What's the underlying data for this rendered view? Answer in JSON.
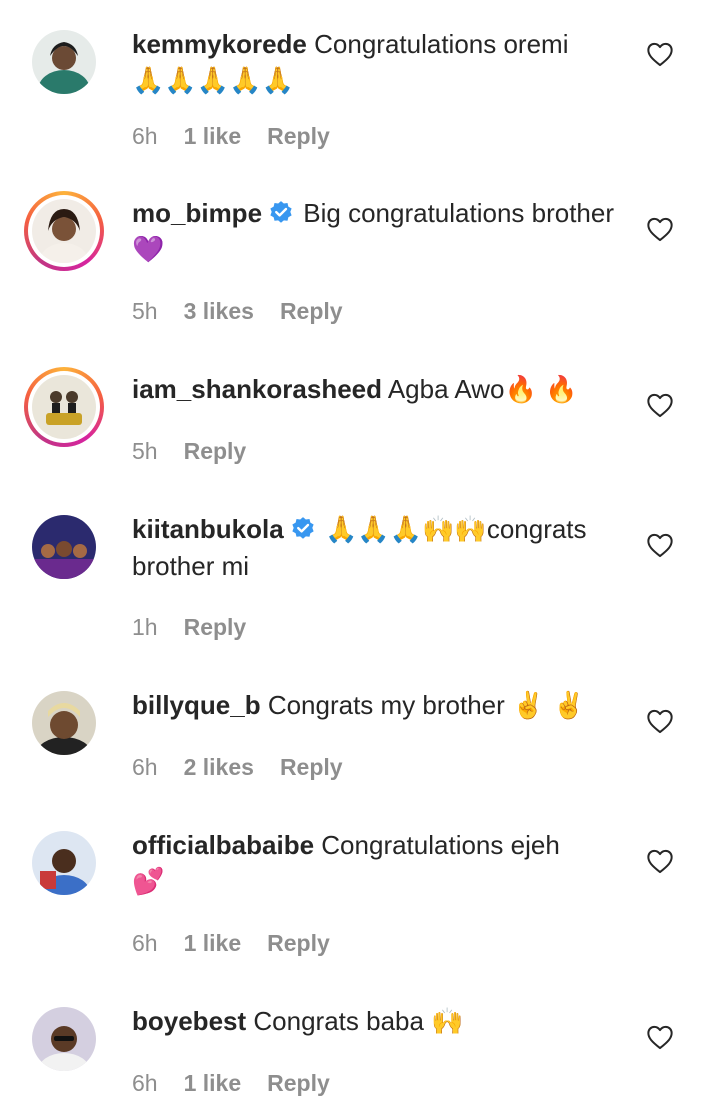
{
  "comments": [
    {
      "username": "kemmykorede",
      "verified": false,
      "text": "Congratulations oremi",
      "emoji_line": "🙏🙏🙏🙏🙏",
      "time": "6h",
      "likes": "1 like",
      "reply": "Reply",
      "story_ring": false,
      "avatar_color": "#2a7a6b"
    },
    {
      "username": "mo_bimpe",
      "verified": true,
      "text": "Big congratulations brother",
      "emoji": "💜",
      "time": "5h",
      "likes": "3 likes",
      "reply": "Reply",
      "story_ring": true,
      "avatar_color": "#d9b89c"
    },
    {
      "username": "iam_shankorasheed",
      "verified": false,
      "text": "Agba Awo",
      "emoji": "🔥 🔥",
      "time": "5h",
      "likes": "",
      "reply": "Reply",
      "story_ring": true,
      "avatar_color": "#e9e4d6"
    },
    {
      "username": "kiitanbukola",
      "verified": true,
      "emoji": "🙏🙏🙏🙌🙌",
      "text": "congrats brother mi",
      "time": "1h",
      "likes": "",
      "reply": "Reply",
      "story_ring": false,
      "avatar_color": "#2b2a6e"
    },
    {
      "username": "billyque_b",
      "verified": false,
      "text": "Congrats my brother",
      "emoji": "✌️ ✌️",
      "time": "6h",
      "likes": "2 likes",
      "reply": "Reply",
      "story_ring": false,
      "avatar_color": "#8a7a5a"
    },
    {
      "username": "officialbabaibe",
      "verified": false,
      "text": "Congratulations ejeh",
      "emoji_line": "💕",
      "time": "6h",
      "likes": "1 like",
      "reply": "Reply",
      "story_ring": false,
      "avatar_color": "#3b6fc7"
    },
    {
      "username": "boyebest",
      "verified": false,
      "text": "Congrats baba",
      "emoji": "🙌",
      "time": "6h",
      "likes": "1 like",
      "reply": "Reply",
      "story_ring": false,
      "avatar_color": "#c7c1cf"
    }
  ],
  "icons": {
    "like": "heart-outline-icon",
    "verified": "verified-badge-icon"
  },
  "colors": {
    "verified": "#3897f0",
    "meta": "#8e8e8e",
    "text": "#262626"
  }
}
